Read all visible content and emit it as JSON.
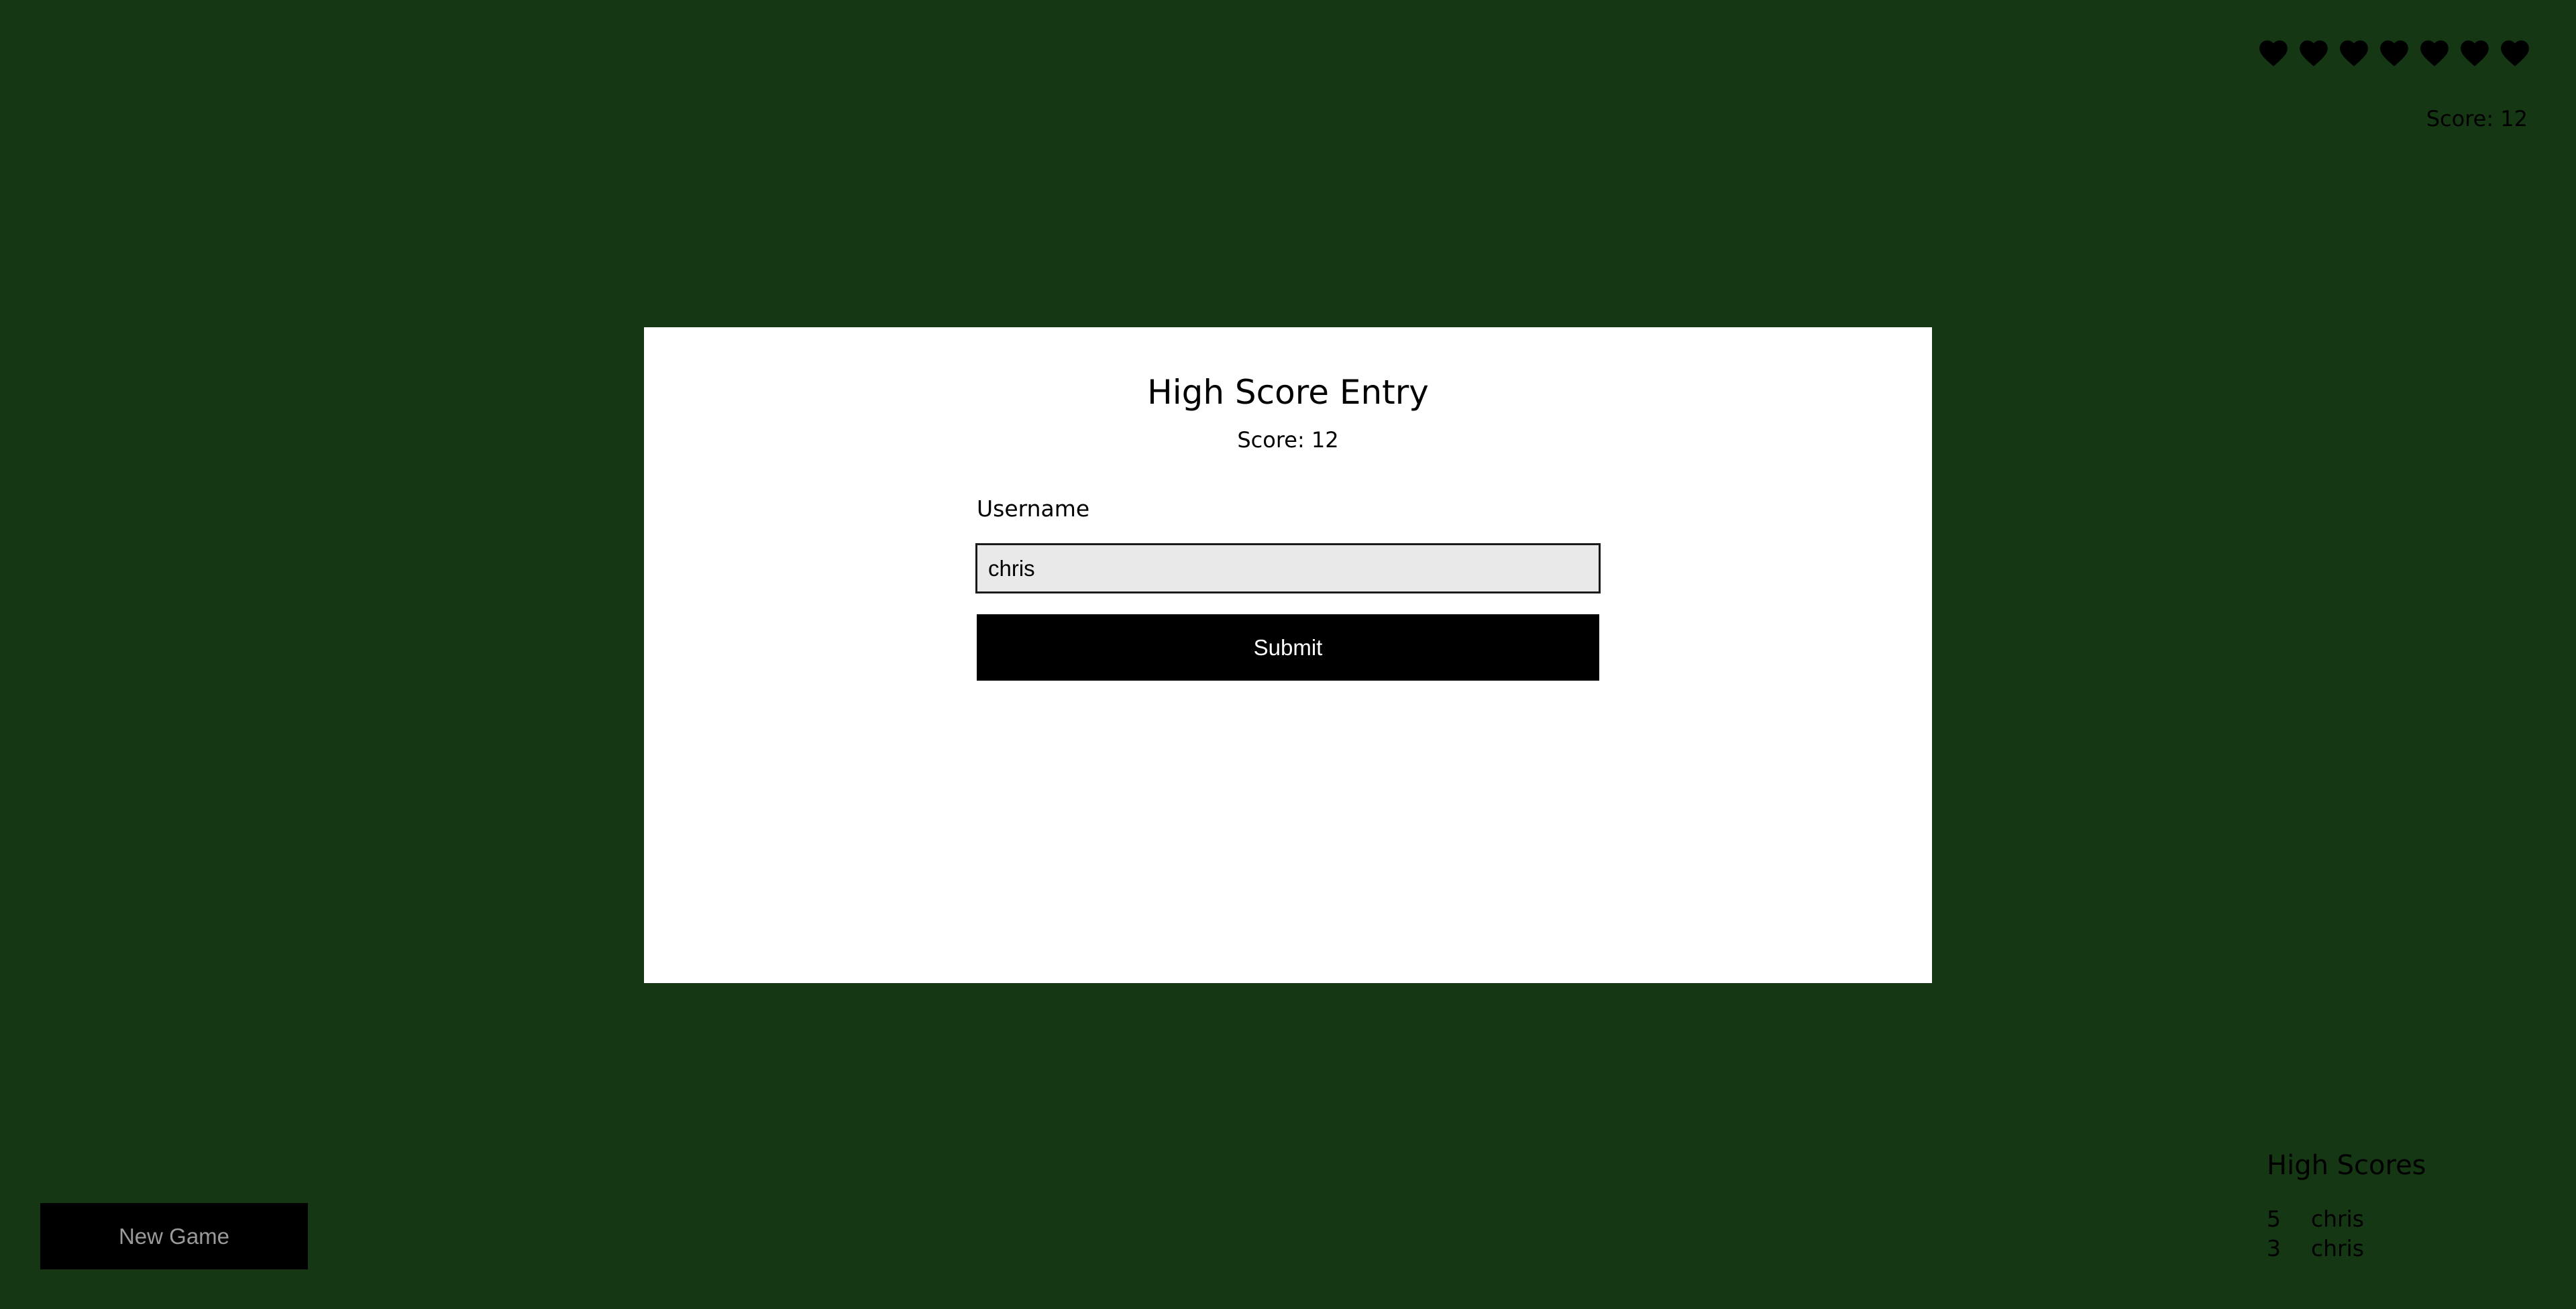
{
  "hud": {
    "lives": 7,
    "heart_color": "#000000",
    "score_text": "Score: 12"
  },
  "modal": {
    "title": "High Score Entry",
    "score_text": "Score: 12",
    "username_label": "Username",
    "username_value": "chris",
    "submit_label": "Submit"
  },
  "controls": {
    "new_game_label": "New Game"
  },
  "high_scores": {
    "title": "High Scores",
    "entries": [
      {
        "score": "5",
        "name": "chris"
      },
      {
        "score": "3",
        "name": "chris"
      }
    ]
  },
  "colors": {
    "background": "#153714",
    "modal": "#ffffff",
    "button": "#000000"
  }
}
